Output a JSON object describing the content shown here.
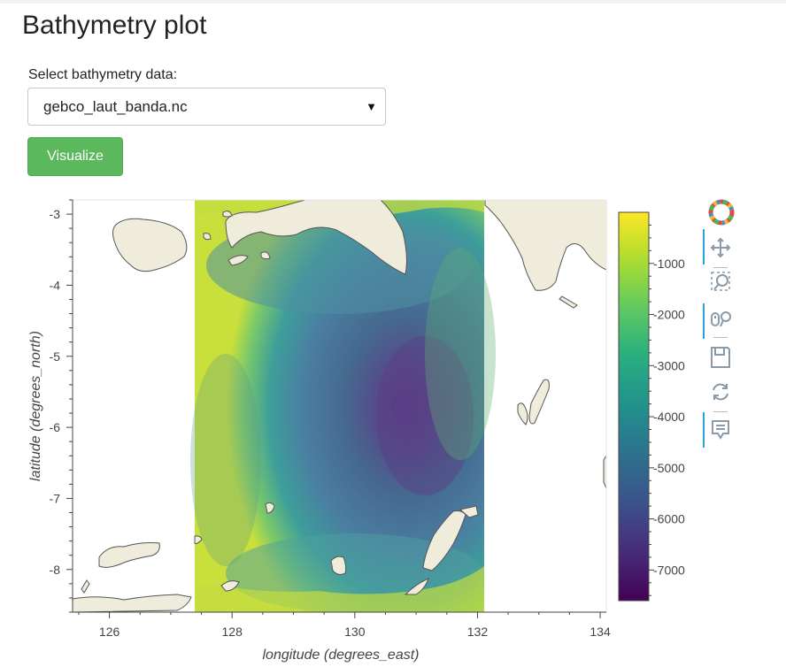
{
  "page": {
    "title": "Bathymetry plot"
  },
  "controls": {
    "select_label": "Select bathymetry data:",
    "selected_file": "gebco_laut_banda.nc",
    "visualize_label": "Visualize"
  },
  "colors": {
    "button": "#5cb85c",
    "land": "#efecdc",
    "coastline": "#555555",
    "active_tool": "#2aa0d8"
  },
  "toolbar": [
    "bokeh-logo-icon",
    "pan-icon",
    "box-zoom-icon",
    "wheel-zoom-icon",
    "save-icon",
    "reset-icon",
    "hover-icon"
  ],
  "chart_data": {
    "type": "heatmap",
    "title": "",
    "xlabel": "longitude (degrees_east)",
    "ylabel": "latitude (degrees_north)",
    "xlim": [
      125.4,
      134.1
    ],
    "ylim": [
      -8.6,
      -2.8
    ],
    "x_ticks": [
      126,
      128,
      130,
      132,
      134
    ],
    "y_ticks": [
      -3,
      -4,
      -5,
      -6,
      -7,
      -8
    ],
    "data_extent": {
      "x": [
        127.35,
        132.05
      ],
      "y": [
        -8.6,
        -2.8
      ]
    },
    "colorbar": {
      "colormap": "viridis",
      "range": [
        -7600,
        0
      ],
      "ticks": [
        -1000,
        -2000,
        -3000,
        -4000,
        -5000,
        -6000,
        -7000
      ]
    },
    "deep_center": {
      "lon": 131.0,
      "lat": -5.6,
      "depth": -7200
    },
    "grid": false
  }
}
